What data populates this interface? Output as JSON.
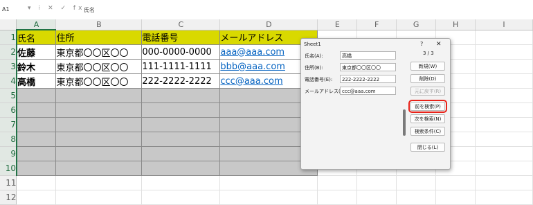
{
  "formula_bar": {
    "name_box": "A1",
    "controls": "▾ ⁝ ✕ ✓ fx",
    "content": "氏名"
  },
  "sheet": {
    "columns": [
      "A",
      "B",
      "C",
      "D",
      "E",
      "F",
      "G",
      "H",
      "I"
    ],
    "rows": [
      "1",
      "2",
      "3",
      "4",
      "5",
      "6",
      "7",
      "8",
      "9",
      "10",
      "11",
      "12"
    ],
    "headers": [
      "氏名",
      "住所",
      "電話番号",
      "メールアドレス"
    ],
    "records": [
      [
        "佐藤",
        "東京都〇〇区〇〇",
        "000-0000-0000",
        "aaa@aaa.com"
      ],
      [
        "鈴木",
        "東京都〇〇区〇〇",
        "111-1111-1111",
        "bbb@aaa.com"
      ],
      [
        "高橋",
        "東京都〇〇区〇〇",
        "222-2222-2222",
        "ccc@aaa.com"
      ]
    ]
  },
  "dialog": {
    "title": "Sheet1",
    "help": "?",
    "close": "✕",
    "counter": "3 / 3",
    "fields": [
      {
        "label": "氏名(A):",
        "value": "高橋"
      },
      {
        "label": "住所(B):",
        "value": "東京都〇〇区〇〇"
      },
      {
        "label": "電話番号(E):",
        "value": "222-2222-2222"
      },
      {
        "label": "メールアドレス(G):",
        "value": "ccc@aaa.com"
      }
    ],
    "buttons": {
      "new": "新規(W)",
      "delete": "削除(D)",
      "restore": "元に戻す(R)",
      "find_prev": "前を検索(P)",
      "find_next": "次を検索(N)",
      "criteria": "検索条件(C)",
      "close": "閉じる(L)"
    }
  },
  "colors": {
    "header_fill": "#d9d900",
    "blank_fill": "#c8c8c8",
    "highlight": "#e8231a",
    "link": "#0563c1"
  }
}
